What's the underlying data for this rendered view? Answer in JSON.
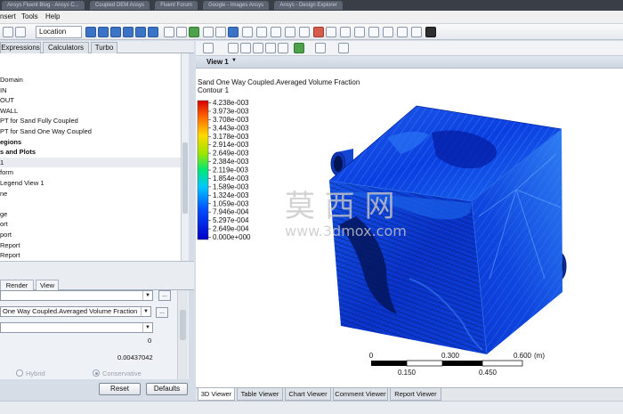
{
  "browser_tabs": [
    "Ansys Fluent Blog - Ansys C...",
    "Coupled DEM Ansys",
    "Fluent Forum",
    "Google - Images Ansys",
    "Ansys - Design Explorer"
  ],
  "menu": [
    "nsert",
    "Tools",
    "Help"
  ],
  "toolbar": {
    "location_label": "Location"
  },
  "left_tabs": [
    "Expressions",
    "Calculators",
    "Turbo"
  ],
  "tree_items": [
    {
      "label": "Domain",
      "bold": false,
      "selected": false
    },
    {
      "label": "IN",
      "bold": false,
      "selected": false
    },
    {
      "label": "OUT",
      "bold": false,
      "selected": false
    },
    {
      "label": "WALL",
      "bold": false,
      "selected": false
    },
    {
      "label": "PT for Sand Fully Coupled",
      "bold": false,
      "selected": false
    },
    {
      "label": "PT for Sand One Way Coupled",
      "bold": false,
      "selected": false
    },
    {
      "label": "egions",
      "bold": true,
      "selected": false
    },
    {
      "label": "s and Plots",
      "bold": true,
      "selected": false
    },
    {
      "label": "1",
      "bold": false,
      "selected": true
    },
    {
      "label": "form",
      "bold": false,
      "selected": false
    },
    {
      "label": "Legend View 1",
      "bold": false,
      "selected": false
    },
    {
      "label": "ne",
      "bold": false,
      "selected": false
    },
    {
      "label": "",
      "bold": false,
      "selected": false
    },
    {
      "label": "ge",
      "bold": false,
      "selected": false
    },
    {
      "label": "ort",
      "bold": false,
      "selected": false
    },
    {
      "label": "port",
      "bold": false,
      "selected": false
    },
    {
      "label": "Report",
      "bold": false,
      "selected": false
    },
    {
      "label": "Report",
      "bold": false,
      "selected": false
    }
  ],
  "detail_tabs": [
    "Render",
    "View"
  ],
  "details": {
    "variable": "One Way Coupled.Averaged Volume Fraction",
    "dots": "...",
    "value_min": "0",
    "value_max": "0.00437042",
    "radio_hybrid": "Hybrid",
    "radio_conservative": "Conservative"
  },
  "buttons": {
    "reset": "Reset",
    "defaults": "Defaults"
  },
  "view": {
    "title": "View 1"
  },
  "legend": {
    "title": "Sand One Way Coupled.Averaged Volume Fraction",
    "subtitle": "Contour 1",
    "labels": [
      "4.238e-003",
      "3.973e-003",
      "3.708e-003",
      "3.443e-003",
      "3.178e-003",
      "2.914e-003",
      "2.649e-003",
      "2.384e-003",
      "2.119e-003",
      "1.854e-003",
      "1.589e-003",
      "1.324e-003",
      "1.059e-003",
      "7.946e-004",
      "5.297e-004",
      "2.649e-004",
      "0.000e+000"
    ]
  },
  "scale": {
    "top_ticks": [
      "0",
      "0.300",
      "0.600"
    ],
    "bottom_ticks": [
      "0.150",
      "0.450"
    ],
    "unit": "(m)"
  },
  "viewer_tabs": [
    "3D Viewer",
    "Table Viewer",
    "Chart Viewer",
    "Comment Viewer",
    "Report Viewer"
  ],
  "watermark": {
    "cn": "莫 西 网",
    "url": "www.3dmox.com"
  },
  "colors": {
    "contour_low": "#0a2ad8",
    "contour_high": "#d51616",
    "accent": "#3b74c6"
  }
}
